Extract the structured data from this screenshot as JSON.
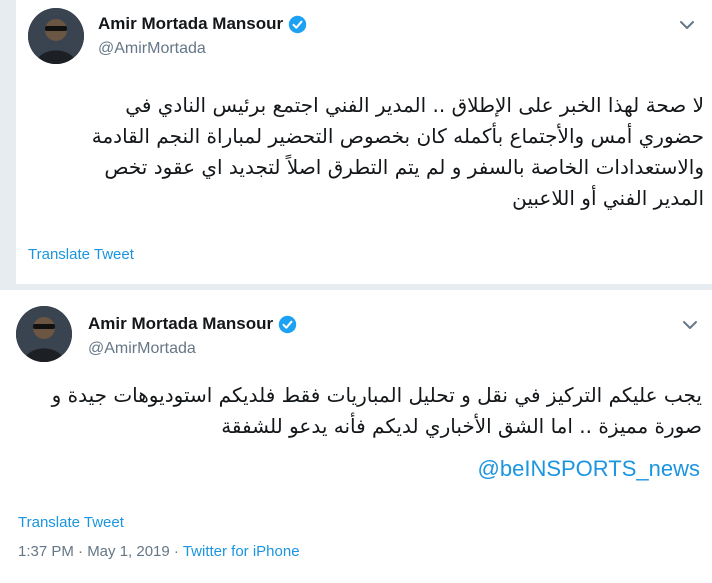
{
  "tweets": [
    {
      "author": {
        "display_name": "Amir Mortada Mansour",
        "handle": "@AmirMortada",
        "verified": true
      },
      "text_lines": [
        "لا صحة لهذا الخبر على الإطلاق .. المدير الفني اجتمع برئيس النادي في",
        "حضوري أمس والأجتماع بأكمله كان بخصوص التحضير لمباراة النجم القادمة",
        "والاستعدادات الخاصة بالسفر و لم يتم التطرق اصلاً لتجديد اي عقود تخص",
        "المدير الفني أو اللاعبين"
      ],
      "translate_label": "Translate Tweet",
      "menu_icon": "chevron-down-icon"
    },
    {
      "author": {
        "display_name": "Amir Mortada Mansour",
        "handle": "@AmirMortada",
        "verified": true
      },
      "text_lines": [
        "يجب عليكم التركيز في نقل و تحليل المباريات فقط فلديكم استوديوهات جيدة و",
        "صورة مميزة .. اما الشق الأخباري لديكم فأنه يدعو للشفقة"
      ],
      "mention": "@beINSPORTS_news",
      "translate_label": "Translate Tweet",
      "timestamp": "1:37 PM · May 1, 2019 · ",
      "source": "Twitter for iPhone",
      "menu_icon": "chevron-down-icon"
    }
  ],
  "colors": {
    "link": "#1b95e0",
    "secondary_text": "#657786",
    "verified_badge": "#1da1f2",
    "strip": "#e6ecf0"
  }
}
